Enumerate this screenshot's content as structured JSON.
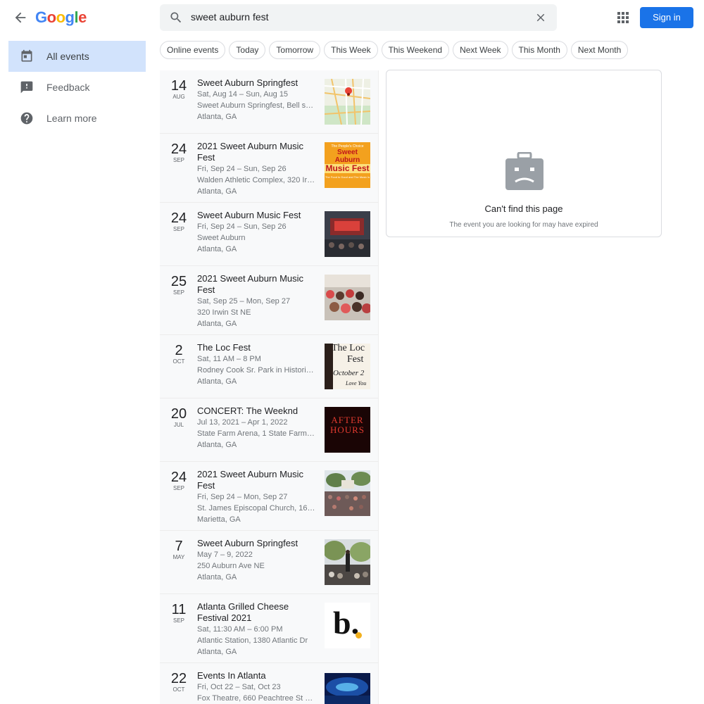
{
  "header": {
    "logo": [
      "G",
      "o",
      "o",
      "g",
      "l",
      "e"
    ],
    "logo_colors": [
      "#4285f4",
      "#ea4335",
      "#fbbc05",
      "#4285f4",
      "#34a853",
      "#ea4335"
    ],
    "search_query": "sweet auburn fest",
    "sign_in": "Sign in"
  },
  "sidebar": {
    "items": [
      {
        "label": "All events",
        "icon": "calendar-icon",
        "active": true
      },
      {
        "label": "Feedback",
        "icon": "feedback-icon",
        "active": false
      },
      {
        "label": "Learn more",
        "icon": "help-icon",
        "active": false
      }
    ]
  },
  "chips": [
    "Online events",
    "Today",
    "Tomorrow",
    "This Week",
    "This Weekend",
    "Next Week",
    "This Month",
    "Next Month"
  ],
  "events": [
    {
      "day": "14",
      "month": "AUG",
      "title": "Sweet Auburn Springfest",
      "dates": "Sat, Aug 14 – Sun, Aug 15",
      "venue": "Sweet Auburn Springfest, Bell str…",
      "city": "Atlanta, GA",
      "thumb": "map"
    },
    {
      "day": "24",
      "month": "SEP",
      "title": "2021 Sweet Auburn Music Fest",
      "dates": "Fri, Sep 24 – Sun, Sep 26",
      "venue": "Walden Athletic Complex, 320 Ir…",
      "city": "Atlanta, GA",
      "thumb": "poster-orange"
    },
    {
      "day": "24",
      "month": "SEP",
      "title": "Sweet Auburn Music Fest",
      "dates": "Fri, Sep 24 – Sun, Sep 26",
      "venue": "Sweet Auburn",
      "city": "Atlanta, GA",
      "thumb": "stage"
    },
    {
      "day": "25",
      "month": "SEP",
      "title": "2021 Sweet Auburn Music Fest",
      "dates": "Sat, Sep 25 – Mon, Sep 27",
      "venue": "320 Irwin St NE",
      "city": "Atlanta, GA",
      "thumb": "crowd"
    },
    {
      "day": "2",
      "month": "OCT",
      "title": "The Loc Fest",
      "dates": "Sat, 11 AM – 8 PM",
      "venue": "Rodney Cook Sr. Park in Historic …",
      "city": "Atlanta, GA",
      "thumb": "loc-fest"
    },
    {
      "day": "20",
      "month": "JUL",
      "title": "CONCERT: The Weeknd",
      "dates": "Jul 13, 2021 – Apr 1, 2022",
      "venue": "State Farm Arena, 1 State Farm Dr",
      "city": "Atlanta, GA",
      "thumb": "after-hours"
    },
    {
      "day": "24",
      "month": "SEP",
      "title": "2021 Sweet Auburn Music Fest",
      "dates": "Fri, Sep 24 – Mon, Sep 27",
      "venue": "St. James Episcopal Church, 161…",
      "city": "Marietta, GA",
      "thumb": "outdoor-crowd"
    },
    {
      "day": "7",
      "month": "MAY",
      "title": "Sweet Auburn Springfest",
      "dates": "May 7 – 9, 2022",
      "venue": "250 Auburn Ave NE",
      "city": "Atlanta, GA",
      "thumb": "performer"
    },
    {
      "day": "11",
      "month": "SEP",
      "title": "Atlanta Grilled Cheese Festival 2021",
      "dates": "Sat, 11:30 AM – 6:00 PM",
      "venue": "Atlantic Station, 1380 Atlantic Dr",
      "city": "Atlanta, GA",
      "thumb": "b-logo"
    },
    {
      "day": "22",
      "month": "OCT",
      "title": "Events In Atlanta",
      "dates": "Fri, Oct 22 – Sat, Oct 23",
      "venue": "Fox Theatre, 660 Peachtree St NE",
      "city": "",
      "thumb": "theatre"
    }
  ],
  "thumb_text": {
    "poster_top": "The People's Choice",
    "poster_main": "Sweet Auburn",
    "poster_main2": "Music Fest",
    "poster_bottom": "The Food is Good and The Music is",
    "loc1": "The Loc",
    "loc2": "Fest",
    "loc3": "October 2",
    "loc4": "Love You",
    "ah1": "AFTER",
    "ah2": "HOURS",
    "b": "b."
  },
  "detail": {
    "title": "Can't find this page",
    "subtitle": "The event you are looking for may have expired"
  },
  "colors": {
    "accent": "#1a73e8",
    "active_bg": "#d2e3fc"
  }
}
